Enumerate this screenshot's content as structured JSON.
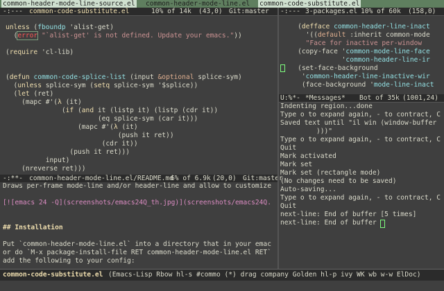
{
  "header_line": {
    "left": "common-header-mode-line-source.el",
    "middle": "common-header-mode-line.el",
    "right": "common-code-substitute.el"
  },
  "left_top": {
    "modeline": {
      "flags": "-:---",
      "buffer": "common-code-substitute.el",
      "position": "10% of 14k",
      "coords": "(43,0)",
      "vcs": "Git:master"
    },
    "lines": [
      "unless (fboundp 'alist-get)",
      "  (error \"`alist-get' is not defined. Update your emacs.\"))",
      "",
      "(require 'cl-lib)",
      "",
      "",
      "(defun common-code-splice-list (input &optional splice-sym)",
      "  (unless splice-sym (setq splice-sym '$splice))",
      "  (let (ret)",
      "    (mapc #'(λ (it)",
      "              (if (and it (listp it) (listp (cdr it))",
      "                       (eq splice-sym (car it)))",
      "                  (mapc #'(λ (it)",
      "                            (push it ret))",
      "                        (cdr it))",
      "                (push it ret)))",
      "          input)",
      "    (nreverse ret)))"
    ]
  },
  "left_bottom": {
    "modeline": {
      "flags": "-:**-",
      "buffer": "common-header-mode-line.el/README.md",
      "position": "6% of 6.9k",
      "coords": "(20,0)",
      "vcs": "Git:master"
    },
    "lines": [
      "Draws per-frame mode-line and/or header-line and allow to customize",
      "",
      "[![emacs 24 -Q](screenshots/emacs24Q_th.jpg)](screenshots/emacs24Q.",
      "",
      "",
      "## Installation",
      "",
      "Put `common-header-mode-line.el` into a directory that in your emac",
      "or do `M-x package-install-file RET common-header-mode-line.el RET`",
      "add the following to your config:"
    ]
  },
  "right_top": {
    "modeline": {
      "flags": "-:---",
      "buffer": "3-packages.el",
      "position": "10% of 60k",
      "coords": "(158,0)"
    },
    "lines": [
      "    (defface common-header-line-inact",
      "      '((default :inherit common-mode",
      "      \"Face for inactive per-window ",
      "    (copy-face 'common-mode-line-face",
      "               'common-header-line-ir",
      "    (set-face-background",
      "     'common-header-line-inactive-wir",
      "     (face-background 'mode-line-inact"
    ]
  },
  "right_bottom": {
    "modeline": {
      "flags": "U:%*-",
      "buffer": "*Messages*",
      "position": "Bot of 35k",
      "coords": "(1001,24)"
    },
    "lines": [
      "Indenting region...done",
      "Type o to expand again, - to contract, C",
      "Saved text until \"il win (window-buffer",
      "         )))\"",
      "Type o to expand again, - to contract, C",
      "Quit",
      "Mark activated",
      "Mark set",
      "Mark set (rectangle mode)",
      "(No changes need to be saved)",
      "Auto-saving...",
      "Type o to expand again, - to contract, C",
      "Quit",
      "next-line: End of buffer [5 times]",
      "next-line: End of buffer"
    ]
  },
  "bottom_modeline": {
    "buffer": "common-code-substitute.el",
    "modes": "(Emacs-Lisp Rbow hl-s #commo (*) drag company Golden hl-p ivy WK wb w-w ElDoc)"
  },
  "colors": {
    "background": "#3f3f3f",
    "foreground": "#dcdccc",
    "header_bg": "#5f7f5f",
    "modeline_bg": "#2b2b2b",
    "active_buffer": "#f0dfaf",
    "keyword": "#f0dfaf",
    "function": "#93e0e3",
    "string": "#cc9393",
    "error": "#ff5555"
  }
}
